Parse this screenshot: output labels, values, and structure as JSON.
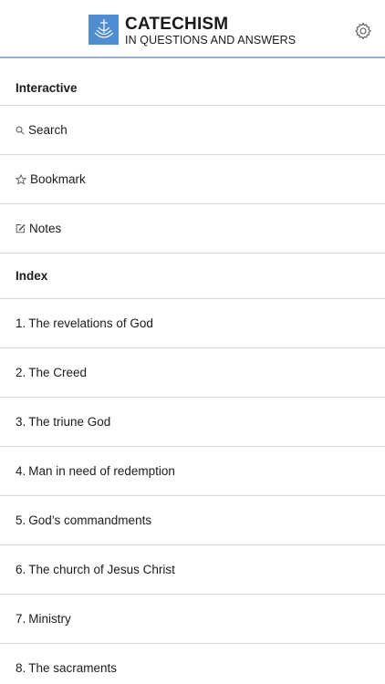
{
  "header": {
    "title": "CATECHISM",
    "subtitle": "IN QUESTIONS AND ANSWERS"
  },
  "interactive": {
    "heading": "Interactive",
    "items": [
      {
        "label": "Search",
        "icon": "search-icon"
      },
      {
        "label": "Bookmark",
        "icon": "star-icon"
      },
      {
        "label": "Notes",
        "icon": "edit-note-icon"
      }
    ]
  },
  "index": {
    "heading": "Index",
    "items": [
      {
        "num": "1.",
        "label": "The revelations of God"
      },
      {
        "num": "2.",
        "label": "The Creed"
      },
      {
        "num": "3.",
        "label": "The triune God"
      },
      {
        "num": "4.",
        "label": "Man in need of redemption"
      },
      {
        "num": "5.",
        "label": "God’s commandments"
      },
      {
        "num": "6.",
        "label": "The church of Jesus Christ"
      },
      {
        "num": "7.",
        "label": "Ministry"
      },
      {
        "num": "8.",
        "label": "The sacraments"
      }
    ]
  },
  "colors": {
    "logo": "#4f8dd1",
    "header_border": "#9aaed6",
    "divider": "#d6d6d6"
  }
}
